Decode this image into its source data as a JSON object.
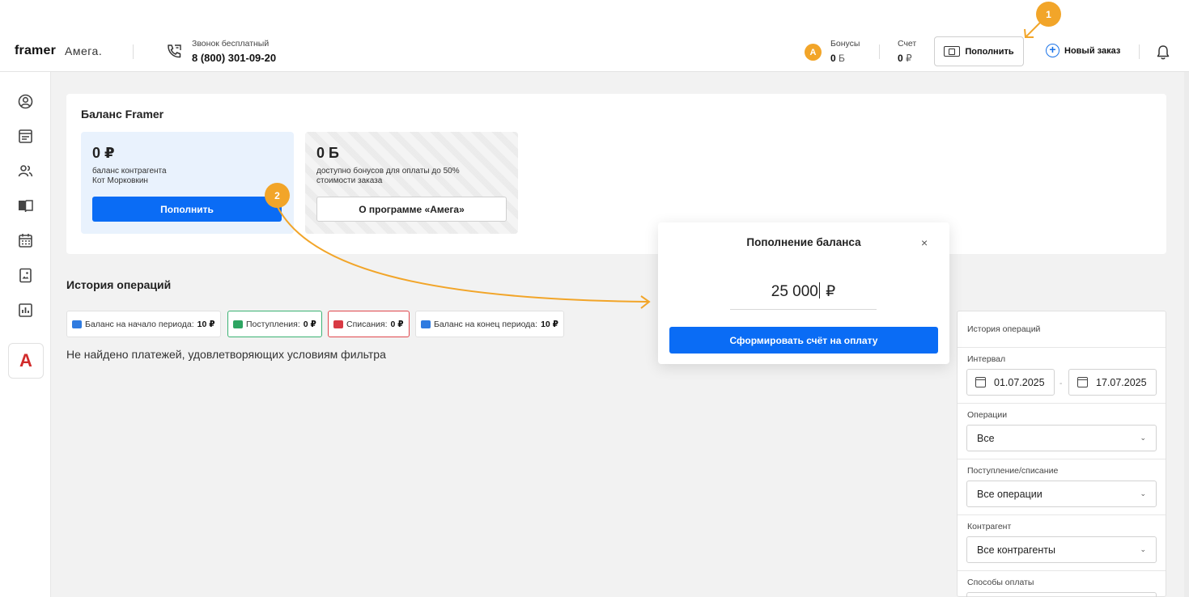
{
  "header": {
    "logo_framer": "framer",
    "logo_amega": "Амега.",
    "phone_caption": "Звонок бесплатный",
    "phone_number": "8 (800) 301-09-20",
    "bonus_icon_letter": "A",
    "bonus_label": "Бонусы",
    "bonus_value": "0",
    "bonus_unit": "Б",
    "account_label": "Счет",
    "account_value": "0",
    "account_unit": "₽",
    "topup_label": "Пополнить",
    "new_order_label": "Новый заказ"
  },
  "steps": {
    "step1": "1",
    "step2": "2"
  },
  "sidebar": {
    "icons": [
      "user-circle-icon",
      "document-icon",
      "users-icon",
      "book-icon",
      "calendar-icon",
      "gallery-icon",
      "chart-icon"
    ],
    "logo_letter": "A"
  },
  "balance": {
    "title": "Баланс Framer",
    "card1_amount": "0 ₽",
    "card1_desc_line1": "баланс контрагента",
    "card1_desc_line2": "Кот Морковкин",
    "card1_button": "Пополнить",
    "card2_amount": "0 Б",
    "card2_desc_line1": "доступно бонусов для оплаты до 50%",
    "card2_desc_line2": "стоимости заказа",
    "card2_button": "О программе «Амега»"
  },
  "history": {
    "title": "История операций",
    "chips": {
      "start_label": "Баланс на начало периода:",
      "start_value": "10 ₽",
      "income_label": "Поступления:",
      "income_value": "0 ₽",
      "outcome_label": "Списания:",
      "outcome_value": "0 ₽",
      "end_label": "Баланс на конец периода:",
      "end_value": "10 ₽"
    },
    "empty_text": "Не найдено платежей, удовлетворяющих условиям фильтра"
  },
  "filters": {
    "head": "История операций",
    "interval_label": "Интервал",
    "date_from": "01.07.2025",
    "date_to": "17.07.2025",
    "date_dash": "-",
    "operations_label": "Операции",
    "operations_value": "Все",
    "flow_label": "Поступление/списание",
    "flow_value": "Все операции",
    "contractor_label": "Контрагент",
    "contractor_value": "Все контрагенты",
    "payment_label": "Способы оплаты"
  },
  "modal": {
    "title": "Пополнение баланса",
    "close": "×",
    "amount": "25 000",
    "currency": "₽",
    "button": "Сформировать счёт на оплату"
  },
  "colors": {
    "accent": "#0a6cf5",
    "annotation": "#f2a529",
    "income": "#3bb273",
    "outcome": "#e0474c"
  }
}
